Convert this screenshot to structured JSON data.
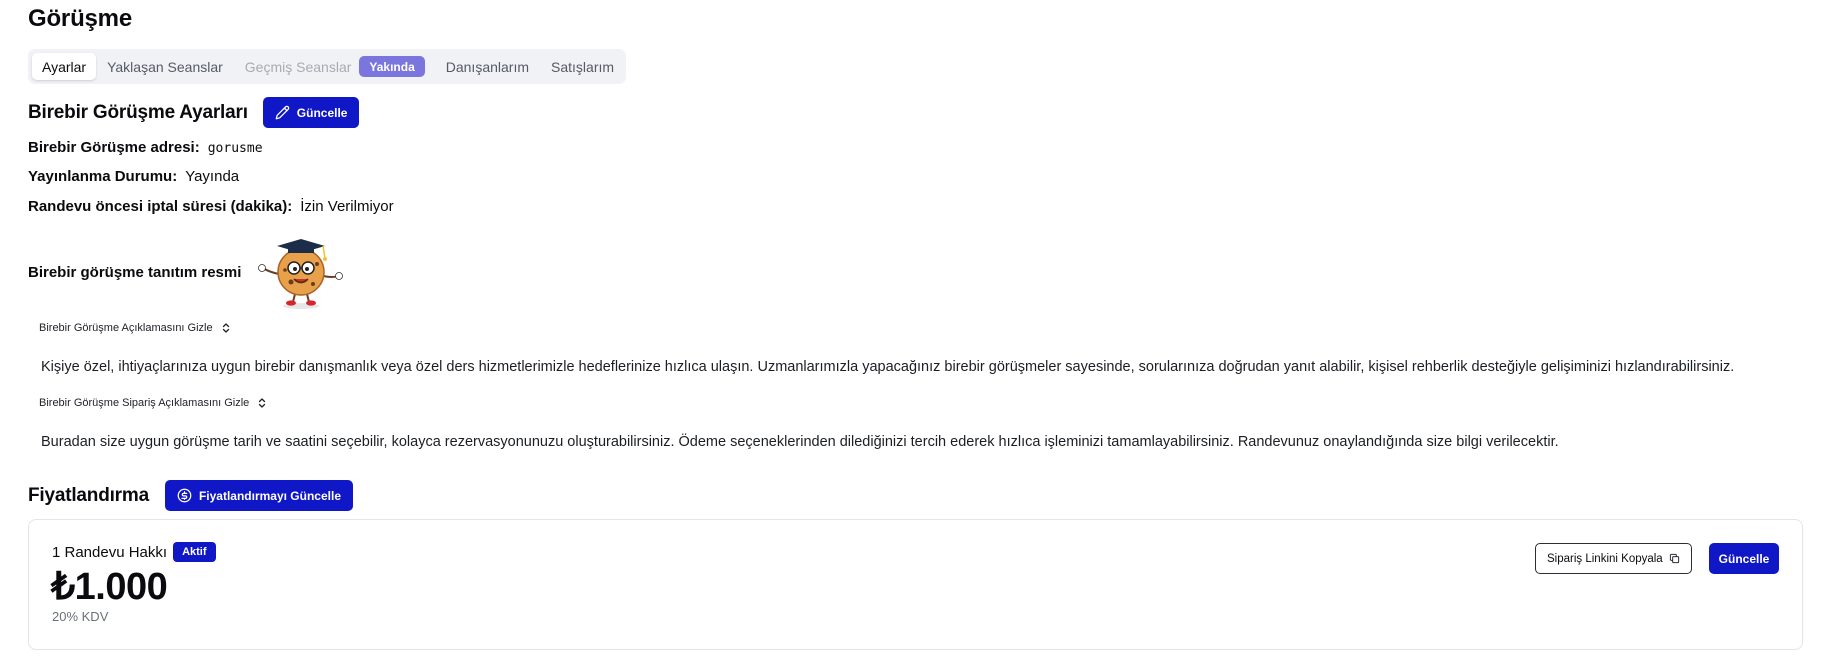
{
  "page": {
    "title": "Görüşme"
  },
  "tabs": [
    {
      "label": "Ayarlar"
    },
    {
      "label": "Yaklaşan Seanslar"
    },
    {
      "label": "Geçmiş Seanslar"
    },
    {
      "label": "Yakında"
    },
    {
      "label": "Danışanlarım"
    },
    {
      "label": "Satışlarım"
    }
  ],
  "settings": {
    "title": "Birebir Görüşme Ayarları",
    "update_button": "Güncelle",
    "address_label": "Birebir Görüşme adresi:",
    "address_value": "gorusme",
    "publish_label": "Yayınlanma Durumu:",
    "publish_value": "Yayında",
    "cancel_label": "Randevu öncesi iptal süresi (dakika):",
    "cancel_value": "İzin Verilmiyor",
    "image_label": "Birebir görüşme tanıtım resmi",
    "desc_toggle": "Birebir Görüşme Açıklamasını Gizle",
    "desc_text": "Kişiye özel, ihtiyaçlarınıza uygun birebir danışmanlık veya özel ders hizmetlerimizle hedeflerinize hızlıca ulaşın. Uzmanlarımızla yapacağınız birebir görüşmeler sayesinde, sorularınıza doğrudan yanıt alabilir, kişisel rehberlik desteğiyle gelişiminizi hızlandırabilirsiniz.",
    "order_toggle": "Birebir Görüşme Sipariş Açıklamasını Gizle",
    "order_text": "Buradan size uygun görüşme tarih ve saatini seçebilir, kolayca rezervasyonunuzu oluşturabilirsiniz. Ödeme seçeneklerinden dilediğinizi tercih ederek hızlıca işleminizi tamamlayabilirsiniz. Randevunuz onaylandığında size bilgi verilecektir."
  },
  "pricing": {
    "title": "Fiyatlandırma",
    "update_button": "Fiyatlandırmayı Güncelle",
    "plan": {
      "name": "1 Randevu Hakkı",
      "status": "Aktif",
      "price": "₺1.000",
      "tax": "20% KDV",
      "copy_button": "Sipariş Linkini Kopyala",
      "update_button": "Güncelle"
    }
  },
  "colors": {
    "primary": "#0f17c7",
    "badge_soon": "#7b76de"
  },
  "icons": [
    "pencil-icon",
    "dollar-circle-icon",
    "chevron-up-down-icon",
    "copy-icon"
  ]
}
